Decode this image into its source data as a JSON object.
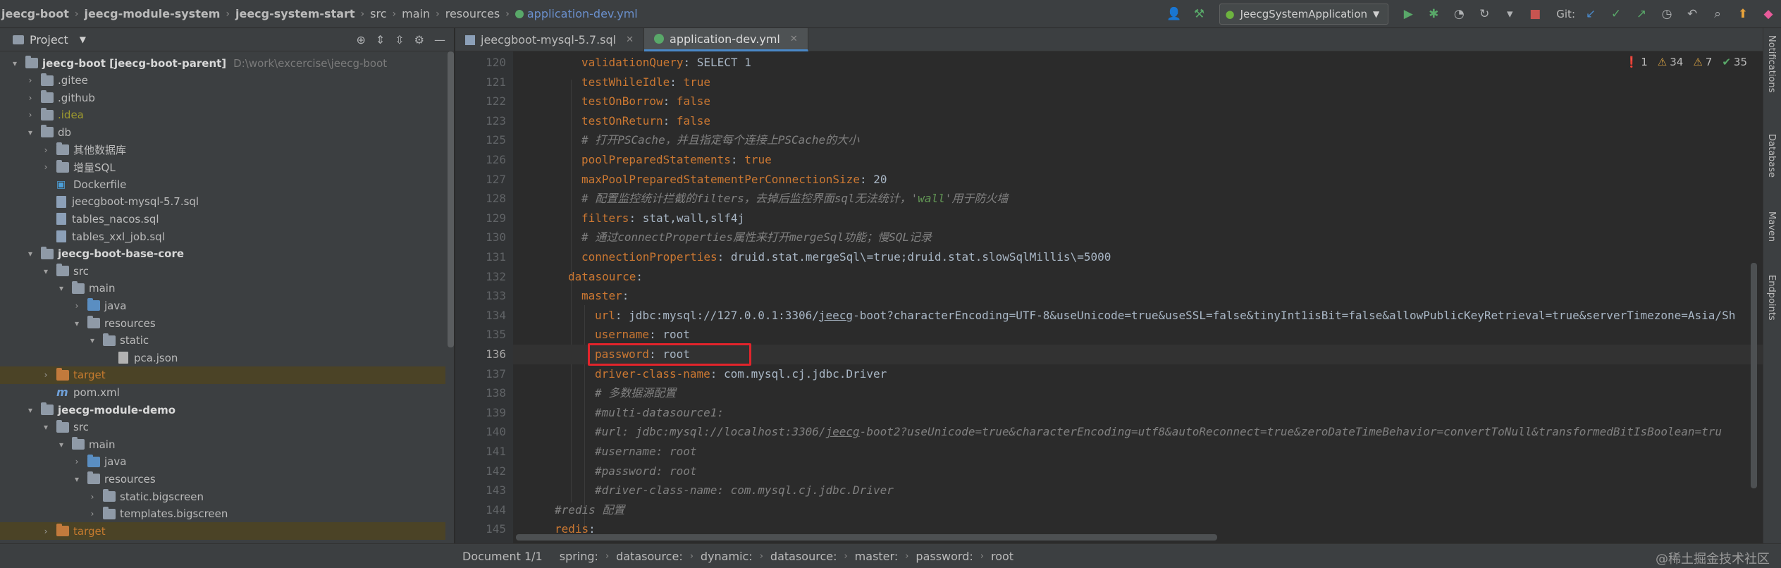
{
  "breadcrumbs": [
    "jeecg-boot",
    "jeecg-module-system",
    "jeecg-system-start",
    "src",
    "main",
    "resources",
    "application-dev.yml"
  ],
  "toolbar": {
    "run_config": "JeecgSystemApplication",
    "git_label": "Git:"
  },
  "project_panel": {
    "title": "Project"
  },
  "tree": [
    {
      "arrow": "▾",
      "name": "jeecg-boot [jeecg-boot-parent]",
      "extra": "D:\\work\\excercise\\jeecg-boot",
      "icon": "folder",
      "style": "bold",
      "level": 0
    },
    {
      "arrow": "›",
      "name": ".gitee",
      "icon": "folder",
      "style": "",
      "level": 1
    },
    {
      "arrow": "›",
      "name": ".github",
      "icon": "folder",
      "style": "",
      "level": 1
    },
    {
      "arrow": "›",
      "name": ".idea",
      "icon": "folder",
      "style": "olive",
      "level": 1
    },
    {
      "arrow": "▾",
      "name": "db",
      "icon": "folder",
      "style": "",
      "level": 1
    },
    {
      "arrow": "›",
      "name": "其他数据库",
      "icon": "folder",
      "style": "",
      "level": 2
    },
    {
      "arrow": "›",
      "name": "增量SQL",
      "icon": "folder",
      "style": "",
      "level": 2
    },
    {
      "arrow": "",
      "name": "Dockerfile",
      "icon": "docker",
      "style": "",
      "level": 2
    },
    {
      "arrow": "",
      "name": "jeecgboot-mysql-5.7.sql",
      "icon": "sql",
      "style": "",
      "level": 2
    },
    {
      "arrow": "",
      "name": "tables_nacos.sql",
      "icon": "sql",
      "style": "",
      "level": 2
    },
    {
      "arrow": "",
      "name": "tables_xxl_job.sql",
      "icon": "sql",
      "style": "",
      "level": 2
    },
    {
      "arrow": "▾",
      "name": "jeecg-boot-base-core",
      "icon": "folder",
      "style": "bold",
      "level": 1
    },
    {
      "arrow": "▾",
      "name": "src",
      "icon": "folder",
      "style": "",
      "level": 2
    },
    {
      "arrow": "▾",
      "name": "main",
      "icon": "folder",
      "style": "",
      "level": 3
    },
    {
      "arrow": "›",
      "name": "java",
      "icon": "folder-blue",
      "style": "",
      "level": 4
    },
    {
      "arrow": "▾",
      "name": "resources",
      "icon": "folder",
      "style": "",
      "level": 4
    },
    {
      "arrow": "▾",
      "name": "static",
      "icon": "folder",
      "style": "",
      "level": 5
    },
    {
      "arrow": "",
      "name": "pca.json",
      "icon": "json",
      "style": "",
      "level": 6
    },
    {
      "arrow": "›",
      "name": "target",
      "icon": "folder-orange",
      "style": "target",
      "level": 2,
      "highlight": true
    },
    {
      "arrow": "",
      "name": "pom.xml",
      "icon": "maven",
      "style": "",
      "level": 2
    },
    {
      "arrow": "▾",
      "name": "jeecg-module-demo",
      "icon": "folder",
      "style": "bold",
      "level": 1
    },
    {
      "arrow": "▾",
      "name": "src",
      "icon": "folder",
      "style": "",
      "level": 2
    },
    {
      "arrow": "▾",
      "name": "main",
      "icon": "folder",
      "style": "",
      "level": 3
    },
    {
      "arrow": "›",
      "name": "java",
      "icon": "folder-blue",
      "style": "",
      "level": 4
    },
    {
      "arrow": "▾",
      "name": "resources",
      "icon": "folder",
      "style": "",
      "level": 4
    },
    {
      "arrow": "›",
      "name": "static.bigscreen",
      "icon": "folder",
      "style": "",
      "level": 5
    },
    {
      "arrow": "›",
      "name": "templates.bigscreen",
      "icon": "folder",
      "style": "",
      "level": 5
    },
    {
      "arrow": "›",
      "name": "target",
      "icon": "folder-orange",
      "style": "target",
      "level": 2,
      "highlight": true
    },
    {
      "arrow": "",
      "name": "pom.xml",
      "icon": "maven",
      "style": "",
      "level": 2
    }
  ],
  "tabs": [
    {
      "label": "jeecgboot-mysql-5.7.sql",
      "icon": "sql",
      "active": false
    },
    {
      "label": "application-dev.yml",
      "icon": "yml",
      "active": true
    }
  ],
  "inspections": {
    "errors": "1",
    "warnings": "34",
    "weak": "7",
    "ok": "35"
  },
  "current_line": 136,
  "code_lines": [
    {
      "n": 120,
      "indent": 3,
      "parts": [
        [
          "k",
          "validationQuery"
        ],
        [
          "v",
          ": SELECT 1"
        ]
      ]
    },
    {
      "n": 121,
      "indent": 3,
      "parts": [
        [
          "k",
          "testWhileIdle"
        ],
        [
          "v",
          ": "
        ],
        [
          "p",
          "true"
        ]
      ]
    },
    {
      "n": 122,
      "indent": 3,
      "parts": [
        [
          "k",
          "testOnBorrow"
        ],
        [
          "v",
          ": "
        ],
        [
          "p",
          "false"
        ]
      ]
    },
    {
      "n": 123,
      "indent": 3,
      "parts": [
        [
          "k",
          "testOnReturn"
        ],
        [
          "v",
          ": "
        ],
        [
          "p",
          "false"
        ]
      ]
    },
    {
      "n": 125,
      "indent": 3,
      "parts": [
        [
          "c",
          "# 打开PSCache，并且指定每个连接上PSCache的大小"
        ]
      ]
    },
    {
      "n": 126,
      "indent": 3,
      "parts": [
        [
          "k",
          "poolPreparedStatements"
        ],
        [
          "v",
          ": "
        ],
        [
          "p",
          "true"
        ]
      ]
    },
    {
      "n": 127,
      "indent": 3,
      "parts": [
        [
          "k",
          "maxPoolPreparedStatementPerConnectionSize"
        ],
        [
          "v",
          ": 20"
        ]
      ]
    },
    {
      "n": 128,
      "indent": 3,
      "parts": [
        [
          "c",
          "# 配置监控统计拦截的filters，去掉后监控界面sql无法统计，'"
        ],
        [
          "cm",
          "wall"
        ],
        [
          "c",
          "'用于防火墙"
        ]
      ]
    },
    {
      "n": 129,
      "indent": 3,
      "parts": [
        [
          "k",
          "filters"
        ],
        [
          "v",
          ": stat,wall,slf4j"
        ]
      ]
    },
    {
      "n": 130,
      "indent": 3,
      "parts": [
        [
          "c",
          "# 通过connectProperties属性来打开mergeSql功能；慢SQL记录"
        ]
      ]
    },
    {
      "n": 131,
      "indent": 3,
      "parts": [
        [
          "k",
          "connectionProperties"
        ],
        [
          "v",
          ": druid.stat.mergeSql\\=true;druid.stat.slowSqlMillis\\=5000"
        ]
      ]
    },
    {
      "n": 132,
      "indent": 2,
      "parts": [
        [
          "k",
          "datasource"
        ],
        [
          "v",
          ":"
        ]
      ]
    },
    {
      "n": 133,
      "indent": 3,
      "parts": [
        [
          "k",
          "master"
        ],
        [
          "v",
          ":"
        ]
      ]
    },
    {
      "n": 134,
      "indent": 4,
      "parts": [
        [
          "k",
          "url"
        ],
        [
          "v",
          ": jdbc:mysql://127.0.0.1:3306/"
        ],
        [
          "u",
          "jeecg"
        ],
        [
          "v",
          "-boot?characterEncoding=UTF-8&useUnicode=true&useSSL=false&tinyInt1isBit=false&allowPublicKeyRetrieval=true&serverTimezone=Asia/Sh"
        ]
      ]
    },
    {
      "n": 135,
      "indent": 4,
      "parts": [
        [
          "k",
          "username"
        ],
        [
          "v",
          ": root"
        ]
      ]
    },
    {
      "n": 136,
      "indent": 4,
      "parts": [
        [
          "k",
          "password"
        ],
        [
          "v",
          ": root"
        ]
      ]
    },
    {
      "n": 137,
      "indent": 4,
      "parts": [
        [
          "k",
          "driver-class-name"
        ],
        [
          "v",
          ": com.mysql.cj.jdbc.Driver"
        ]
      ]
    },
    {
      "n": 138,
      "indent": 4,
      "parts": [
        [
          "c",
          "# 多数据源配置"
        ]
      ]
    },
    {
      "n": 139,
      "indent": 4,
      "parts": [
        [
          "c",
          "#multi-datasource1:"
        ]
      ]
    },
    {
      "n": 140,
      "indent": 4,
      "parts": [
        [
          "c",
          "#url: jdbc:mysql://localhost:3306/"
        ],
        [
          "cu",
          "jeecg"
        ],
        [
          "c",
          "-boot2?useUnicode=true&characterEncoding=utf8&autoReconnect=true&zeroDateTimeBehavior=convertToNull&transformedBitIsBoolean=tru"
        ]
      ]
    },
    {
      "n": 141,
      "indent": 4,
      "parts": [
        [
          "c",
          "#username: root"
        ]
      ]
    },
    {
      "n": 142,
      "indent": 4,
      "parts": [
        [
          "c",
          "#password: root"
        ]
      ]
    },
    {
      "n": 143,
      "indent": 4,
      "parts": [
        [
          "c",
          "#driver-class-name: com.mysql.cj.jdbc.Driver"
        ]
      ]
    },
    {
      "n": 144,
      "indent": 1,
      "parts": [
        [
          "c",
          "#redis 配置"
        ]
      ]
    },
    {
      "n": 145,
      "indent": 1,
      "parts": [
        [
          "k",
          "redis"
        ],
        [
          "v",
          ":"
        ]
      ]
    }
  ],
  "status_breadcrumb": [
    "Document 1/1",
    "spring:",
    "datasource:",
    "dynamic:",
    "datasource:",
    "master:",
    "password:",
    "root"
  ],
  "right_tools": [
    "Notifications",
    "Database",
    "Maven",
    "Endpoints"
  ],
  "watermark": "@稀土掘金技术社区",
  "colors": {
    "highlight_box": "#e2242b",
    "keyword": "#cc7832",
    "comment": "#808080"
  }
}
